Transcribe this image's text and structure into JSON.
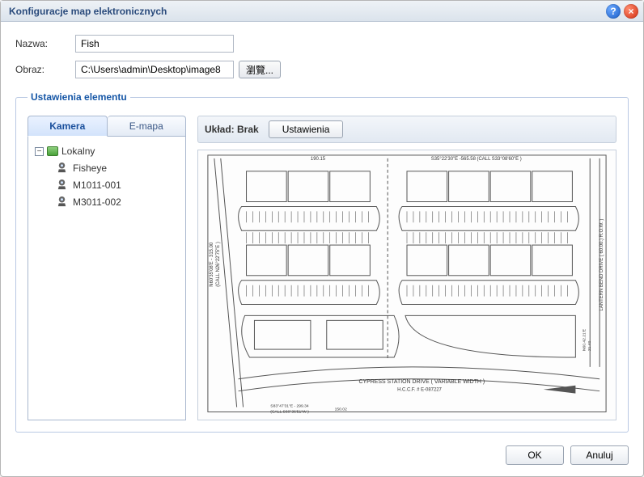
{
  "window": {
    "title": "Konfiguracje map elektronicznych",
    "help_tooltip": "?",
    "close_tooltip": "×"
  },
  "form": {
    "name_label": "Nazwa:",
    "name_value": "Fish",
    "image_label": "Obraz:",
    "image_value": "C:\\Users\\admin\\Desktop\\image8",
    "browse_label": "瀏覽..."
  },
  "group": {
    "legend": "Ustawienia elementu"
  },
  "tabs": {
    "camera": "Kamera",
    "emap": "E-mapa"
  },
  "tree": {
    "root_label": "Lokalny",
    "toggle_symbol": "−",
    "items": [
      {
        "label": "Fisheye"
      },
      {
        "label": "M1011-001"
      },
      {
        "label": "M3011-002"
      }
    ]
  },
  "right": {
    "layout_prefix": "Układ: ",
    "layout_value": "Brak",
    "settings_label": "Ustawienia"
  },
  "map_text": {
    "top_dim": "190.15",
    "top_right": "S35°22'30\"E -565.58  (CALL S33°08'60\"E )",
    "left_callout_a": "N60'35'08'E - 315.00",
    "left_callout_b": "(CALL N26°22'75\"E )",
    "right_side": "LANTERN BEND DRIVE ( 60.00.) R.O.W. )",
    "near_right_a": "N60.42.21'E",
    "near_right_b": "21.40",
    "road_a": "CYPRESS STATION DRIVE ( VARIABLE WIDTH )",
    "road_b": "H.C.C.F. # E-087227",
    "bottom_dim_a": "S83°47'31\"E - 299.34",
    "bottom_dim_b": "(CALL S60°36'51\"W )",
    "bottom_dim_c": "150.02"
  },
  "footer": {
    "ok": "OK",
    "cancel": "Anuluj"
  }
}
